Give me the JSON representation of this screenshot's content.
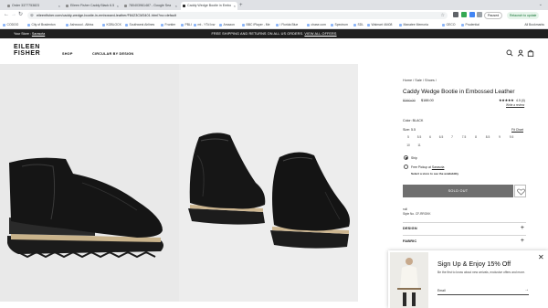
{
  "browser": {
    "tabs": [
      {
        "label": "Order 3377753823"
      },
      {
        "label": "Eileen Fisher Caddy Black 6.5"
      },
      {
        "label": "780403961487 - Google Sea"
      },
      {
        "label": "Caddy Wedge Bootie in Embo"
      }
    ],
    "new_tab": "+",
    "url": "eileenfisher.com/caddy-wedge-bootie-in-embossed-leather/F8423CM3401.html?no=default",
    "profile_paused": "Paused",
    "relaunch": "Relaunch to update",
    "bookmarks": [
      "CODOO",
      "City of Bradenton",
      "Ashwood - Albiss",
      "KOBLOCK",
      "Southwest Airlines",
      "Frontier",
      "PBLI",
      "mt - YTd lvw",
      "Amazon",
      "BBC iPlayer - Me",
      "i Florida Blue",
      "chase.com",
      "Spectrum",
      "SDL",
      "Walmart 46408",
      "Manatee Memoria",
      "GECO",
      "Prudential"
    ],
    "all_bookmarks": "All Bookmarks"
  },
  "promo": {
    "store_label": "Your Store :",
    "store_link": "Sarasota",
    "message": "FREE SHIPPING AND RETURNS ON ALL US ORDERS.",
    "offers_link": "VIEW ALL OFFERS"
  },
  "header": {
    "logo_line1": "EILEEN",
    "logo_line2": "FISHER",
    "nav": [
      "SHOP",
      "CIRCULAR BY DESIGN"
    ],
    "icons": [
      "search-icon",
      "account-icon",
      "bag-icon"
    ]
  },
  "product": {
    "breadcrumb": "Home / Sale / Shoes /",
    "title": "Caddy Wedge Bootie in Embossed Leather",
    "old_price": "$260.00",
    "price": "$188.00",
    "rating_stars": "★★★★★",
    "rating": "4.0 (4)",
    "write_review": "Write a review",
    "color_label": "Color: BLACK",
    "size_label": "Size: 5.5",
    "fit_chart": "Fit Chart",
    "sizes": [
      "5",
      "5.5",
      "6",
      "6.5",
      "7",
      "7.5",
      "8",
      "8.5",
      "9",
      "9.5",
      "10",
      "11"
    ],
    "ship_label": "Ship",
    "pickup_label": "Free Pickup at",
    "pickup_store": "Sarasota",
    "select_store": "Select a store to see the availability",
    "button": "SOLD OUT",
    "color_name": "null",
    "style_no": "Style No. CF-RROKK",
    "accordions": [
      "DESIGN",
      "FABRIC"
    ]
  },
  "popup": {
    "title": "Sign Up & Enjoy 15% Off",
    "description": "Be the first to know about new arrivals, exclusive offers and more.",
    "email_label": "Email",
    "submit": "→",
    "close": "✕"
  },
  "colors": {
    "promo_bg": "#1f1f1f",
    "sold_out_bg": "#6f6f6f",
    "relaunch_bg": "#e6f4ea"
  }
}
